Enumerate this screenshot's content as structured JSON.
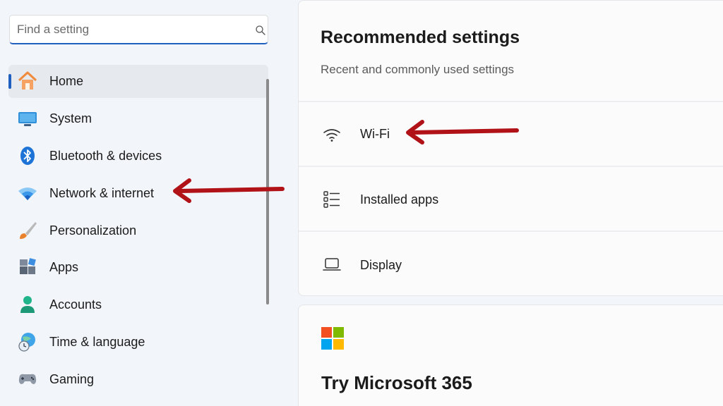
{
  "search": {
    "placeholder": "Find a setting"
  },
  "sidebar": {
    "items": [
      {
        "label": "Home",
        "icon": "home-icon",
        "selected": true
      },
      {
        "label": "System",
        "icon": "monitor-icon"
      },
      {
        "label": "Bluetooth & devices",
        "icon": "bluetooth-icon"
      },
      {
        "label": "Network & internet",
        "icon": "wifi-icon"
      },
      {
        "label": "Personalization",
        "icon": "brush-icon"
      },
      {
        "label": "Apps",
        "icon": "apps-icon"
      },
      {
        "label": "Accounts",
        "icon": "account-icon"
      },
      {
        "label": "Time & language",
        "icon": "globe-clock-icon"
      },
      {
        "label": "Gaming",
        "icon": "gamepad-icon"
      }
    ]
  },
  "recommended": {
    "title": "Recommended settings",
    "subtitle": "Recent and commonly used settings",
    "items": [
      {
        "label": "Wi-Fi",
        "icon": "wifi-icon"
      },
      {
        "label": "Installed apps",
        "icon": "list-icon"
      },
      {
        "label": "Display",
        "icon": "laptop-icon"
      }
    ]
  },
  "promo": {
    "title": "Try Microsoft 365",
    "icon": "microsoft-logo-icon"
  },
  "colors": {
    "accent": "#1f5fbf",
    "arrow": "#b01217",
    "background": "#f2f5f9"
  }
}
